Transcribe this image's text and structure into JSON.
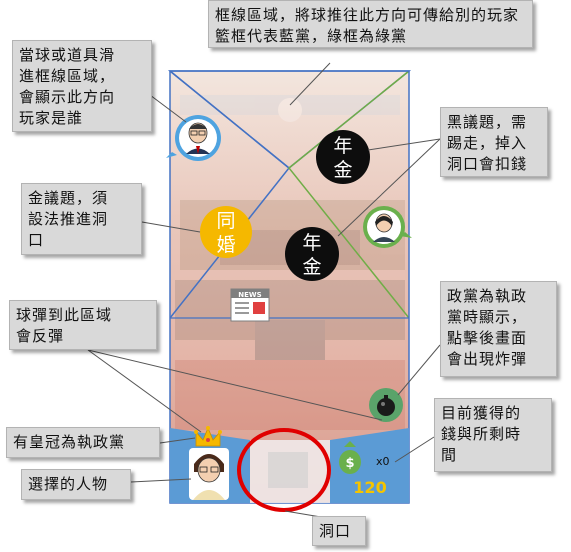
{
  "callouts": {
    "goal_zone": "框線區域，將球推往此方向可傳給別的玩家\n籃框代表藍黨，綠框為綠黨",
    "direction_player": "當球或道具滑\n進框線區域，\n會顯示此方向\n玩家是誰",
    "black_issue": "黑議題，需\n踢走，掉入\n洞口會扣錢",
    "gold_issue": "金議題，須\n設法推進洞\n口",
    "bounce_zone": "球彈到此區域\n會反彈",
    "bomb": "政黨為執政\n黨時顯示，\n點擊後畫面\n會出現炸彈",
    "money_time": "目前獲得的\n錢與所剩時\n間",
    "crown": "有皇冠為執政黨",
    "selected_character": "選擇的人物",
    "hole": "洞口"
  },
  "game": {
    "black_issue_1": [
      "年",
      "金"
    ],
    "black_issue_2": [
      "年",
      "金"
    ],
    "gold_issue": [
      "同",
      "婚"
    ],
    "news_label": "NEWS",
    "money_count": "x0",
    "timer": "120",
    "money_symbol": "$"
  },
  "colors": {
    "blue_frame": "#4472c4",
    "green_frame": "#70ad47",
    "gold": "#f5b800",
    "black": "#0d0d0d",
    "panel_blue": "#5b9bd5",
    "hole_ring": "#e00000",
    "timer_text": "#f5c400"
  }
}
